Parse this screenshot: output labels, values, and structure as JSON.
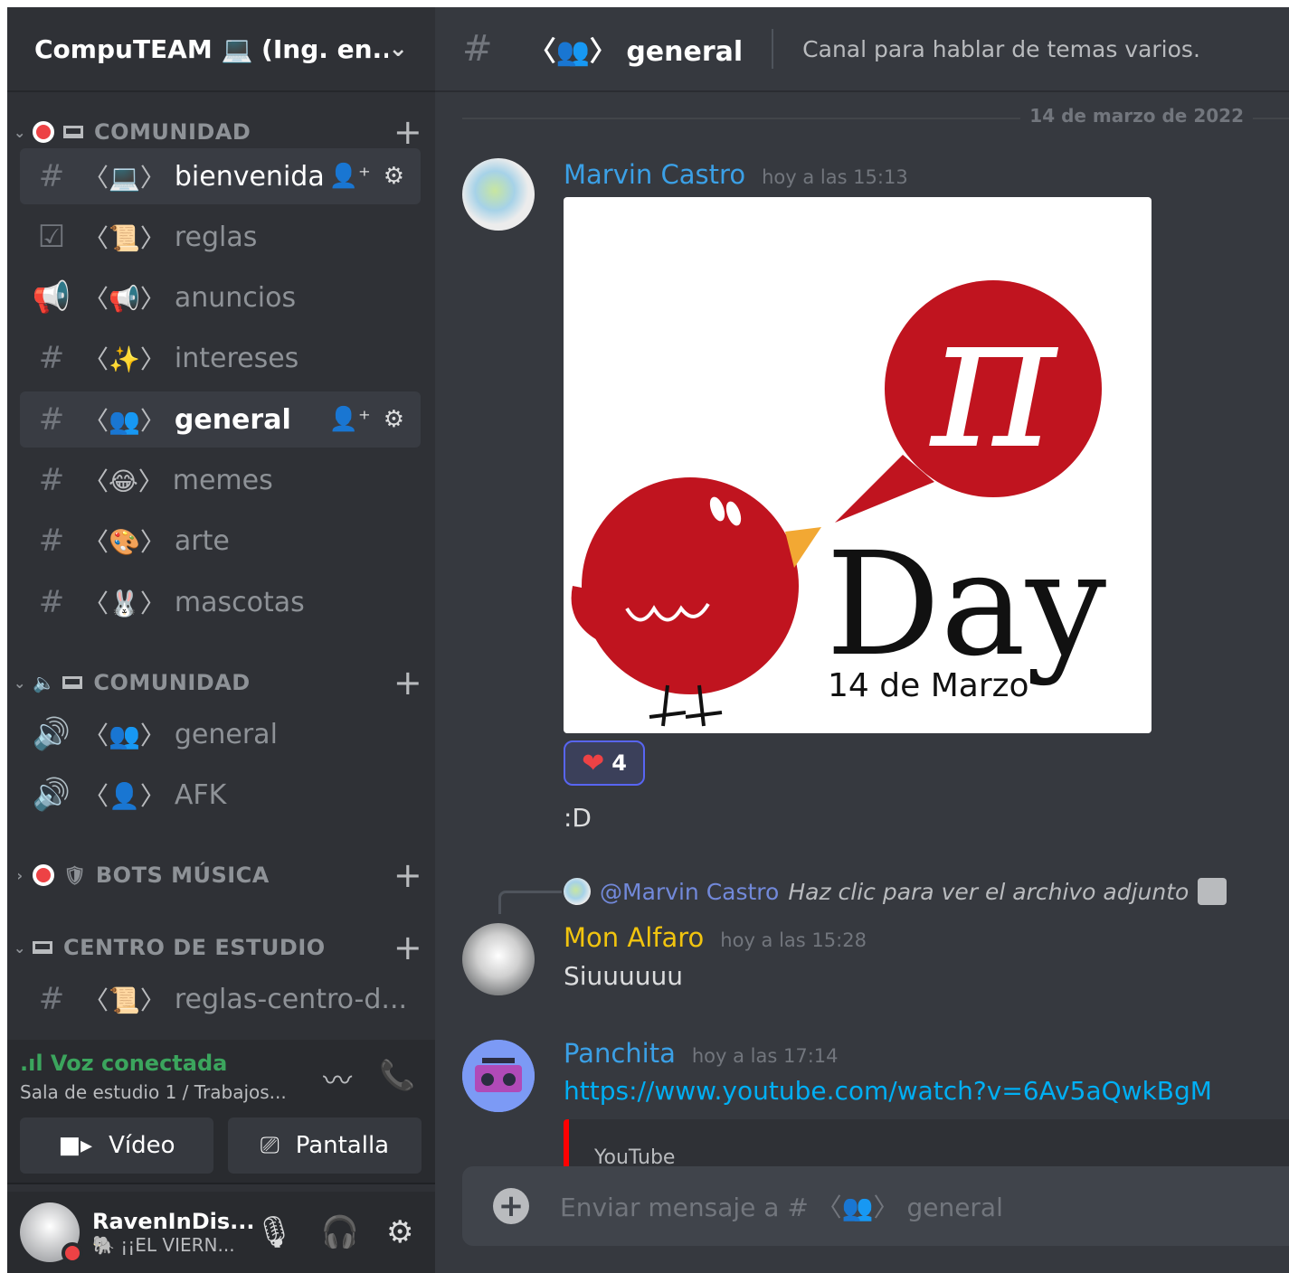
{
  "server": {
    "name": "CompuTEAM 💻 (Ing. en...",
    "chevron": "chevron-down-icon"
  },
  "categories": [
    {
      "label": "COMUNIDAD",
      "arrow": "⌄"
    },
    {
      "label": "COMUNIDAD",
      "arrow": "⌄"
    },
    {
      "label": "BOTS MÚSICA",
      "arrow": "›"
    },
    {
      "label": "CENTRO DE ESTUDIO",
      "arrow": "⌄"
    }
  ],
  "channels": [
    {
      "type": "#",
      "emoji": "〈💻〉",
      "name": "bienvenida"
    },
    {
      "type": "☑",
      "emoji": "〈📜〉",
      "name": "reglas"
    },
    {
      "type": "📢",
      "emoji": "〈📢〉",
      "name": "anuncios"
    },
    {
      "type": "#",
      "emoji": "〈✨〉",
      "name": "intereses"
    },
    {
      "type": "#",
      "emoji": "〈👥〉",
      "name": "general"
    },
    {
      "type": "#",
      "emoji": "〈😂〉",
      "name": "memes"
    },
    {
      "type": "#",
      "emoji": "〈🎨〉",
      "name": "arte"
    },
    {
      "type": "#",
      "emoji": "〈🐰〉",
      "name": "mascotas"
    }
  ],
  "voice_channels": [
    {
      "type": "🔊",
      "emoji": "〈👥〉",
      "name": "general"
    },
    {
      "type": "🔊",
      "emoji": "〈👤〉",
      "name": "AFK"
    }
  ],
  "study_channels": [
    {
      "type": "#",
      "emoji": "〈📜〉",
      "name": "reglas-centro-d..."
    }
  ],
  "voice": {
    "status": ".ıl Voz conectada",
    "location": "Sala de estudio 1 / Trabajos...",
    "video_label": "Vídeo",
    "screen_label": "Pantalla"
  },
  "user": {
    "name": "RavenInDis...",
    "status": "🐘 ¡¡EL VIERN..."
  },
  "channel_header": {
    "hash": "#",
    "title": "〈👥〉 general",
    "topic": "Canal para hablar de temas varios."
  },
  "date_divider": "14 de marzo de 2022",
  "messages": [
    {
      "author": "Marvin Castro",
      "time": "hoy a las 15:13",
      "author_color": "#3ba0e6",
      "image": {
        "big_text": "Day",
        "sub_text": "14 de Marzo",
        "symbol": "π"
      },
      "reaction": {
        "emoji": "❤",
        "count": "4"
      },
      "text": ":D"
    },
    {
      "author": "Mon Alfaro",
      "time": "hoy a las 15:28",
      "author_color": "#f1c40f",
      "reply": {
        "mention": "@Marvin Castro",
        "text": "Haz clic para ver el archivo adjunto"
      },
      "text": "Siuuuuuu"
    },
    {
      "author": "Panchita",
      "time": "hoy a las 17:14",
      "author_color": "#3ba0e6",
      "link": "https://www.youtube.com/watch?v=6Av5aQwkBgM",
      "embed_provider": "YouTube"
    }
  ],
  "composer": {
    "placeholder": "Enviar mensaje a # 〈👥〉 general"
  }
}
